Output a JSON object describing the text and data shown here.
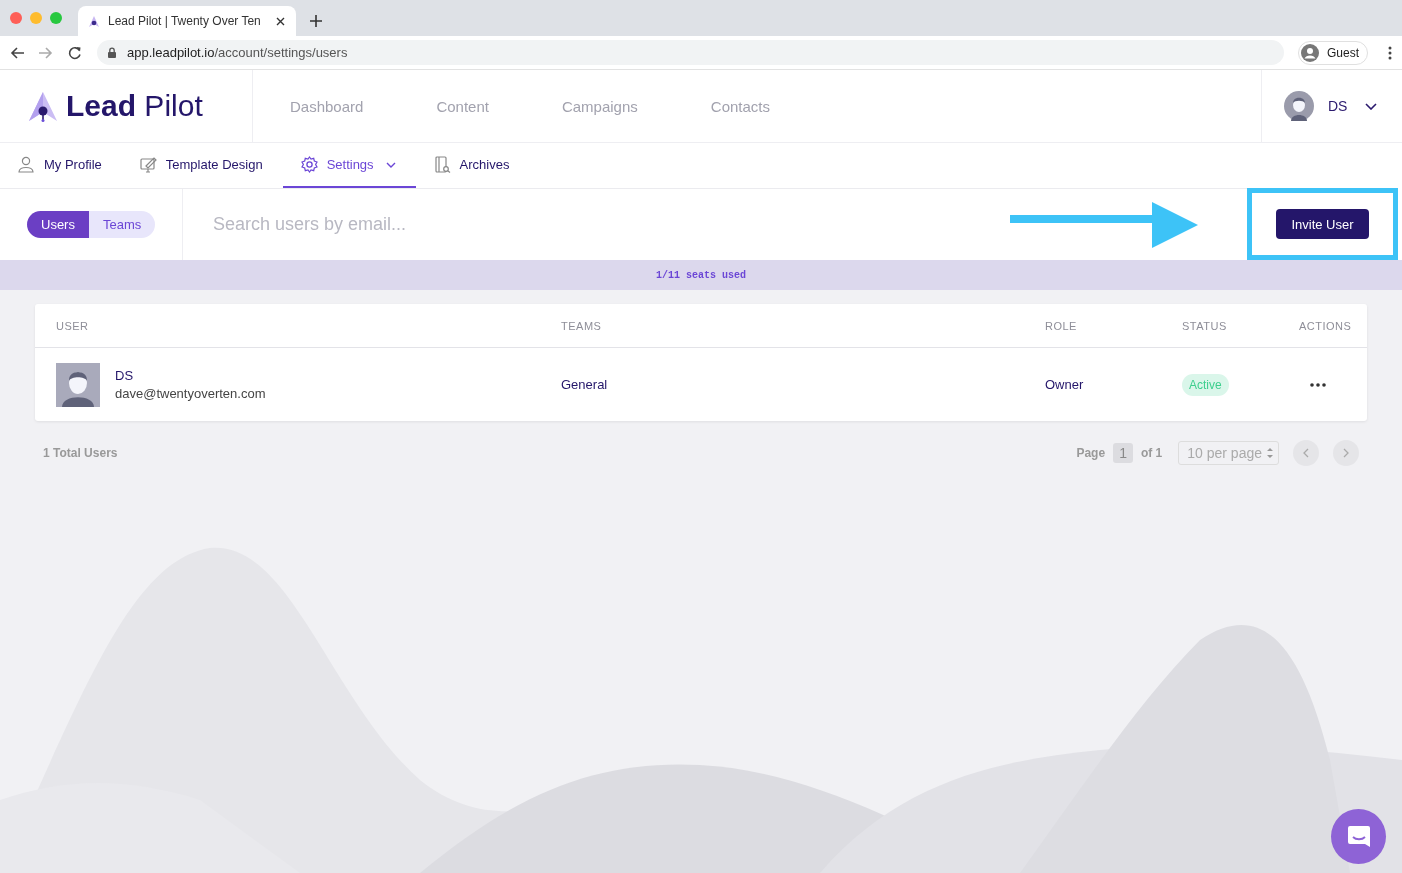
{
  "browser": {
    "tab_title": "Lead Pilot | Twenty Over Ten",
    "url_host": "app.leadpilot.io",
    "url_path": "/account/settings/users",
    "profile_label": "Guest"
  },
  "header": {
    "logo": "**Lead** Pilot",
    "nav": [
      {
        "label": "Dashboard"
      },
      {
        "label": "Content"
      },
      {
        "label": "Campaigns"
      },
      {
        "label": "Contacts"
      }
    ],
    "user_initials": "DS"
  },
  "subnav": [
    {
      "label": "My Profile",
      "kind": "person",
      "selected": false,
      "dropdown": false
    },
    {
      "label": "Template Design",
      "kind": "design",
      "selected": false,
      "dropdown": false
    },
    {
      "label": "Settings",
      "kind": "gear",
      "selected": true,
      "dropdown": true
    },
    {
      "label": "Archives",
      "kind": "archive",
      "selected": false,
      "dropdown": false
    }
  ],
  "toolbar": {
    "toggle": [
      {
        "label": "Users",
        "selected": true
      },
      {
        "label": "Teams",
        "selected": false
      }
    ],
    "search_placeholder": "Search users by email...",
    "invite_button": "Invite User"
  },
  "seats_banner": "1/11 seats used",
  "table": {
    "columns": [
      "USER",
      "TEAMS",
      "ROLE",
      "STATUS",
      "ACTIONS"
    ],
    "rows": [
      {
        "name": "DS",
        "email": "dave@twentyoverten.com",
        "team": "General",
        "role": "Owner",
        "status": "Active"
      }
    ]
  },
  "footer": {
    "total": "1 Total Users",
    "page_label": "Page",
    "page": "1",
    "of": "of 1",
    "per_page": "10 per page"
  }
}
